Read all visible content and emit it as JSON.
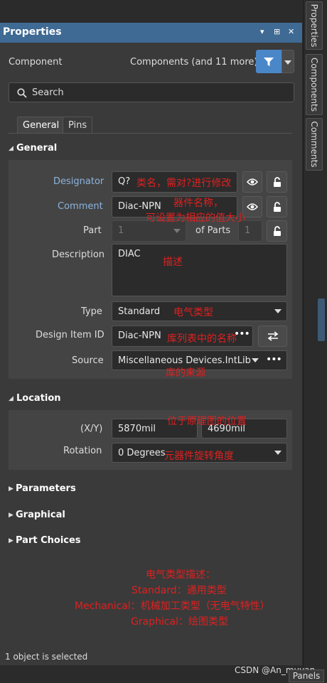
{
  "panel": {
    "title": "Properties",
    "controls": [
      "▾",
      "⊞",
      "✕"
    ]
  },
  "right_tabs": [
    "Properties",
    "Components",
    "Comments"
  ],
  "header": {
    "component_label": "Component",
    "components_text": "Components (and 11 more)"
  },
  "search": {
    "placeholder": "Search"
  },
  "tabs": [
    "General",
    "Pins"
  ],
  "general": {
    "section_title": "General",
    "designator_label": "Designator",
    "designator_value": "Q?",
    "comment_label": "Comment",
    "comment_value": "Diac-NPN",
    "part_label": "Part",
    "part_value": "1",
    "of_parts_label": "of Parts",
    "of_parts_value": "1",
    "description_label": "Description",
    "description_value": "DIAC",
    "type_label": "Type",
    "type_value": "Standard",
    "design_item_label": "Design Item ID",
    "design_item_value": "Diac-NPN",
    "source_label": "Source",
    "source_value": "Miscellaneous Devices.IntLib"
  },
  "location": {
    "section_title": "Location",
    "xy_label": "(X/Y)",
    "x_value": "5870mil",
    "y_value": "4690mil",
    "rotation_label": "Rotation",
    "rotation_value": "0 Degrees"
  },
  "collapsed_sections": [
    "Parameters",
    "Graphical",
    "Part Choices"
  ],
  "annotations": {
    "a1": "类名，需对?进行修改",
    "a2": "器件名称，",
    "a3": "可设置为相应的值大小",
    "a4": "描述",
    "a5": "电气类型",
    "a6": "库列表中的名称",
    "a7": "库的来源",
    "a8": "位于原理图的位置",
    "a9": "元器件旋转角度",
    "a10": "电气类型描述：",
    "a11": "Standard：通用类型",
    "a12": "Mechanical：机械加工类型（无电气特性）",
    "a13": "Graphical：绘图类型"
  },
  "status": {
    "selected": "1 object is selected"
  },
  "watermark": "CSDN @An_muyan",
  "panels_button": "Panels",
  "colors": {
    "title_bar": "#3e6a94",
    "filter_button": "#4a87c8",
    "annotation": "#e02020",
    "link_label": "#8bb4dd"
  }
}
